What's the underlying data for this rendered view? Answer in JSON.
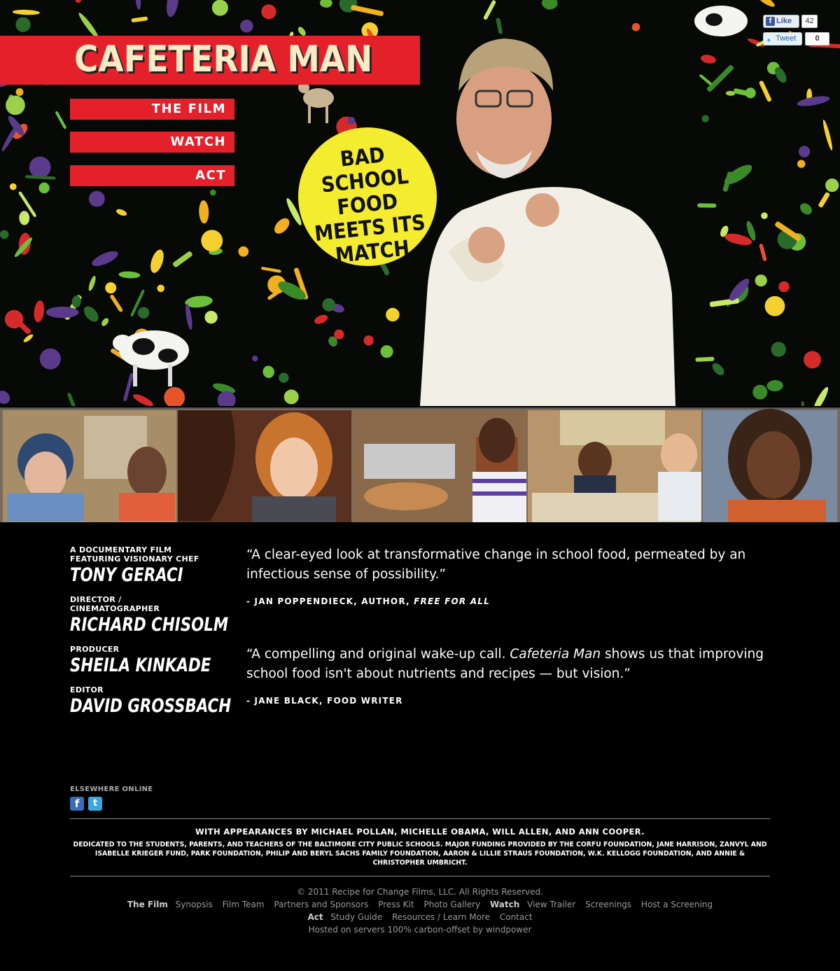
{
  "hero": {
    "title": "CAFETERIA MAN",
    "nav": [
      "THE FILM",
      "WATCH",
      "ACT"
    ],
    "badge_lines": [
      "BAD",
      "SCHOOL FOOD",
      "MEETS ITS",
      "MATCH"
    ],
    "colors": {
      "red": "#e4202a",
      "badge_yellow": "#f4ec2e",
      "title_cream": "#f6ecc6"
    }
  },
  "social_widgets": {
    "like_label": "Like",
    "like_count": "42",
    "tweet_label": "Tweet",
    "tweet_count": "0"
  },
  "credits": [
    {
      "role": "A DOCUMENTARY FILM\nFEATURING VISIONARY CHEF",
      "name": "TONY GERACI"
    },
    {
      "role": "DIRECTOR /\nCINEMATOGRAPHER",
      "name": "RICHARD CHISOLM"
    },
    {
      "role": "PRODUCER",
      "name": "SHEILA KINKADE"
    },
    {
      "role": "EDITOR",
      "name": "DAVID GROSSBACH"
    }
  ],
  "quotes": [
    {
      "text_before": "“A clear-eyed look at transformative change in school food, permeated by an infectious sense of possibility.”",
      "attribution": "- JAN POPPENDIECK, AUTHOR, ",
      "attribution_em": "FREE FOR ALL"
    },
    {
      "text_before": "“A compelling and original wake-up call. ",
      "text_em": "Cafeteria Man",
      "text_after": " shows us that improving school food isn't about nutrients and recipes — but vision.”",
      "attribution": "- JANE BLACK, FOOD WRITER"
    }
  ],
  "elsewhere": {
    "label": "ELSEWHERE ONLINE",
    "icons": [
      "facebook-icon",
      "twitter-icon"
    ]
  },
  "footer": {
    "appearances": "WITH APPEARANCES BY MICHAEL POLLAN, MICHELLE OBAMA, WILL ALLEN, AND ANN COOPER.",
    "dedication": "DEDICATED TO THE STUDENTS, PARENTS, AND TEACHERS OF THE BALTIMORE CITY PUBLIC SCHOOLS. MAJOR FUNDING PROVIDED BY THE CORFU FOUNDATION, JANE HARRISON, ZANVYL AND ISABELLE KRIEGER FUND, PARK FOUNDATION, PHILIP AND BERYL SACHS FAMILY FOUNDATION, AARON & LILLIE STRAUS FOUNDATION, W.K. KELLOGG FOUNDATION, AND ANNIE & CHRISTOPHER UMBRICHT.",
    "copyright": "© 2011 Recipe for Change Films, LLC. All Rights Reserved.",
    "nav_film_heading": "The Film",
    "nav_film": [
      "Synopsis",
      "Film Team",
      "Partners and Sponsors",
      "Press Kit",
      "Photo Gallery"
    ],
    "nav_watch_heading": "Watch",
    "nav_watch": [
      "View Trailer",
      "Screenings",
      "Host a Screening"
    ],
    "nav_act_heading": "Act",
    "nav_act": [
      "Study Guide",
      "Resources / Learn More",
      "Contact"
    ],
    "hosted": "Hosted on servers 100% carbon-offset by windpower"
  }
}
